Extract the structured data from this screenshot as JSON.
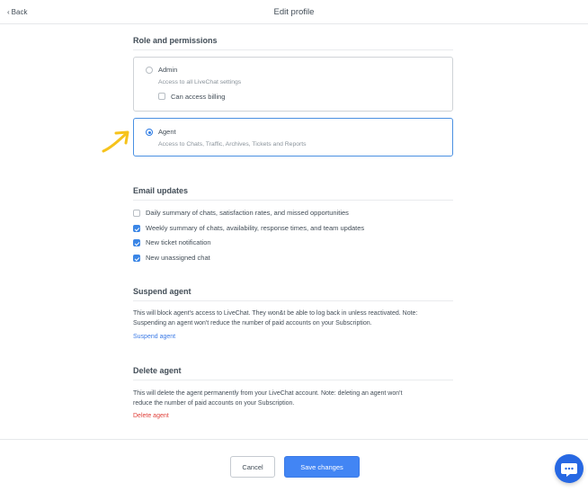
{
  "header": {
    "back_label": "Back",
    "title": "Edit profile"
  },
  "role": {
    "title": "Role and permissions",
    "admin": {
      "label": "Admin",
      "description": "Access to all LiveChat settings",
      "billing_label": "Can access billing",
      "billing_checked": false,
      "selected": false
    },
    "agent": {
      "label": "Agent",
      "description": "Access to Chats, Traffic, Archives, Tickets and Reports",
      "selected": true
    }
  },
  "email": {
    "title": "Email updates",
    "options": [
      {
        "label": "Daily summary of chats, satisfaction rates, and missed opportunities",
        "checked": false
      },
      {
        "label": "Weekly summary of chats, availability, response times, and team updates",
        "checked": true
      },
      {
        "label": "New ticket notification",
        "checked": true
      },
      {
        "label": "New unassigned chat",
        "checked": true
      }
    ]
  },
  "suspend": {
    "title": "Suspend agent",
    "line1": "This will block agent's access to LiveChat. They won&t be able to log back in unless reactivated. Note:",
    "line2": "Suspending an agent won't reduce the number of paid accounts on your Subscription.",
    "link": "Suspend agent"
  },
  "delete": {
    "title": "Delete agent",
    "line1": "This will delete the agent permanently from your LiveChat account. Note: deleting an agent won't",
    "line2": "reduce the number of paid accounts on your Subscription.",
    "link": "Delete agent"
  },
  "footer": {
    "cancel_label": "Cancel",
    "save_label": "Save changes"
  },
  "colors": {
    "primary": "#4285f4",
    "link": "#3b7ae6",
    "danger": "#e0403a",
    "annotation": "#f6c31c",
    "chat": "#2768e3"
  },
  "icons": {
    "back": "chevron-left-icon",
    "annotation": "arrow-annotation-icon",
    "chat": "chat-bubble-icon"
  }
}
